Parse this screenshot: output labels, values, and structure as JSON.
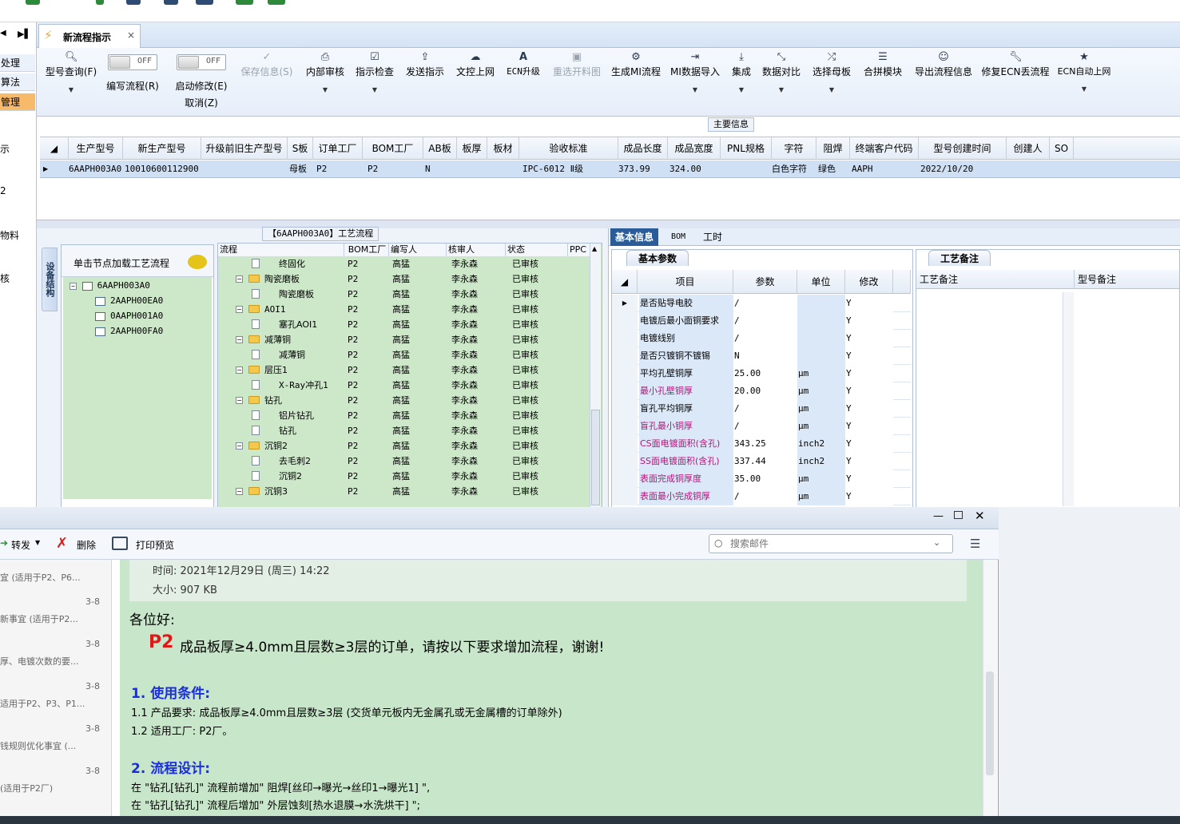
{
  "left_nav": {
    "items": [
      "处理",
      "算法",
      "管理"
    ],
    "plain": [
      "示",
      "2",
      "物料",
      "核"
    ]
  },
  "tab": {
    "label": "新流程指示",
    "close": "×"
  },
  "toolbar": {
    "model_query": "型号查询(F)",
    "write_flow": "编写流程(R)",
    "toggle_off": "OFF",
    "start_modify": "启动修改(E)",
    "cancel": "取消(Z)",
    "save_info": "保存信息(S)",
    "internal_review": "内部审核",
    "instruction_check": "指示检查",
    "send_instruction": "发送指示",
    "doc_upload": "文控上网",
    "ecn_upgrade": "ECN升级",
    "reselect_drawing": "重选开料图",
    "gen_mi_flow": "生成MI流程",
    "mi_import": "MI数据导入",
    "integrate": "集成",
    "data_compare": "数据对比",
    "select_mother": "选择母板",
    "merge_module": "合拼模块",
    "export_flow": "导出流程信息",
    "repair_ecn": "修复ECN丢流程",
    "ecn_auto": "ECN自动上网"
  },
  "main_info": {
    "title": "主要信息",
    "columns": [
      "生产型号",
      "新生产型号",
      "升级前旧生产型号",
      "S板",
      "订单工厂",
      "BOM工厂",
      "AB板",
      "板厚",
      "板材",
      "验收标准",
      "成品长度",
      "成品宽度",
      "PNL规格",
      "字符",
      "阻焊",
      "终端客户代码",
      "型号创建时间",
      "创建人",
      "SO"
    ],
    "row": {
      "prod_model": "6AAPH003A0",
      "new_model": "10010600112900",
      "s_board": "母板",
      "order_factory": "P2",
      "bom_factory": "P2",
      "ab_board": "N",
      "standard": "IPC-6012 Ⅱ级",
      "length": "373.99",
      "width": "324.00",
      "char": "白色字符",
      "solder": "绿色",
      "customer": "AAPH",
      "created": "2022/10/20"
    }
  },
  "process": {
    "title": "【6AAPH003A0】工艺流程",
    "side_tab": "设备结构",
    "load_hint": "单击节点加载工艺流程",
    "tree": [
      "6AAPH003A0",
      "2AAPH00EA0",
      "0AAPH001A0",
      "2AAPH00FA0"
    ],
    "columns": [
      "流程",
      "BOM工厂",
      "编写人",
      "核审人",
      "状态",
      "PPC"
    ],
    "rows": [
      {
        "name": "终固化",
        "level": 2,
        "bom": "P2",
        "writer": "高猛",
        "reviewer": "李永森",
        "status": "已审核"
      },
      {
        "name": "陶瓷磨板",
        "level": 1,
        "bom": "P2",
        "writer": "高猛",
        "reviewer": "李永森",
        "status": "已审核"
      },
      {
        "name": "陶瓷磨板",
        "level": 2,
        "bom": "P2",
        "writer": "高猛",
        "reviewer": "李永森",
        "status": "已审核"
      },
      {
        "name": "AOI1",
        "level": 1,
        "bom": "P2",
        "writer": "高猛",
        "reviewer": "李永森",
        "status": "已审核"
      },
      {
        "name": "塞孔AOI1",
        "level": 2,
        "bom": "P2",
        "writer": "高猛",
        "reviewer": "李永森",
        "status": "已审核"
      },
      {
        "name": "减薄铜",
        "level": 1,
        "bom": "P2",
        "writer": "高猛",
        "reviewer": "李永森",
        "status": "已审核"
      },
      {
        "name": "减薄铜",
        "level": 2,
        "bom": "P2",
        "writer": "高猛",
        "reviewer": "李永森",
        "status": "已审核"
      },
      {
        "name": "层压1",
        "level": 1,
        "bom": "P2",
        "writer": "高猛",
        "reviewer": "李永森",
        "status": "已审核"
      },
      {
        "name": "X-Ray冲孔1",
        "level": 2,
        "bom": "P2",
        "writer": "高猛",
        "reviewer": "李永森",
        "status": "已审核"
      },
      {
        "name": "钻孔",
        "level": 1,
        "bom": "P2",
        "writer": "高猛",
        "reviewer": "李永森",
        "status": "已审核"
      },
      {
        "name": "铝片钻孔",
        "level": 2,
        "bom": "P2",
        "writer": "高猛",
        "reviewer": "李永森",
        "status": "已审核"
      },
      {
        "name": "钻孔",
        "level": 2,
        "bom": "P2",
        "writer": "高猛",
        "reviewer": "李永森",
        "status": "已审核"
      },
      {
        "name": "沉铜2",
        "level": 1,
        "bom": "P2",
        "writer": "高猛",
        "reviewer": "李永森",
        "status": "已审核"
      },
      {
        "name": "去毛刺2",
        "level": 2,
        "bom": "P2",
        "writer": "高猛",
        "reviewer": "李永森",
        "status": "已审核"
      },
      {
        "name": "沉铜2",
        "level": 2,
        "bom": "P2",
        "writer": "高猛",
        "reviewer": "李永森",
        "status": "已审核"
      },
      {
        "name": "沉铜3",
        "level": 1,
        "bom": "P2",
        "writer": "高猛",
        "reviewer": "李永森",
        "status": "已审核"
      }
    ]
  },
  "right_tabs": [
    "基本信息",
    "BOM",
    "工时"
  ],
  "basic": {
    "subtab": "基本参数",
    "columns": [
      "项目",
      "参数",
      "单位",
      "修改"
    ],
    "rows": [
      {
        "item": "是否贴导电胶",
        "param": "/",
        "unit": "",
        "mod": "Y",
        "pink": false
      },
      {
        "item": "电镀后最小面铜要求",
        "param": "/",
        "unit": "",
        "mod": "Y",
        "pink": false
      },
      {
        "item": "电镀线别",
        "param": "/",
        "unit": "",
        "mod": "Y",
        "pink": false
      },
      {
        "item": "是否只镀铜不镀锡",
        "param": "N",
        "unit": "",
        "mod": "Y",
        "pink": false
      },
      {
        "item": "平均孔壁铜厚",
        "param": "25.00",
        "unit": "μm",
        "mod": "Y",
        "pink": false
      },
      {
        "item": "最小孔壁铜厚",
        "param": "20.00",
        "unit": "μm",
        "mod": "Y",
        "pink": true
      },
      {
        "item": "盲孔平均铜厚",
        "param": "/",
        "unit": "μm",
        "mod": "Y",
        "pink": false
      },
      {
        "item": "盲孔最小铜厚",
        "param": "/",
        "unit": "μm",
        "mod": "Y",
        "pink": true
      },
      {
        "item": "CS面电镀面积(含孔)",
        "param": "343.25",
        "unit": "inch2",
        "mod": "Y",
        "pink": true
      },
      {
        "item": "SS面电镀面积(含孔)",
        "param": "337.44",
        "unit": "inch2",
        "mod": "Y",
        "pink": true
      },
      {
        "item": "表面完成铜厚度",
        "param": "35.00",
        "unit": "μm",
        "mod": "Y",
        "pink": true
      },
      {
        "item": "表面最小完成铜厚",
        "param": "/",
        "unit": "μm",
        "mod": "Y",
        "pink": true
      }
    ]
  },
  "notes": {
    "tab": "工艺备注",
    "col1": "工艺备注",
    "col2": "型号备注"
  },
  "mail": {
    "forward": "转发",
    "delete": "删除",
    "print_preview": "打印预览",
    "search_placeholder": "搜索邮件",
    "time": "时间: 2021年12月29日 (周三) 14:22",
    "size": "大小: 907 KB",
    "greeting": "各位好:",
    "lead_factory": "P2",
    "lead_text": "成品板厚≥4.0mm且层数≥3层的订单，请按以下要求增加流程，谢谢!",
    "sec1": "1. 使用条件:",
    "s1_1": "1.1  产品要求: 成品板厚≥4.0mm且层数≥3层 (交货单元板内无金属孔或无金属槽的订单除外)",
    "s1_2": "1.2  适用工厂: P2厂。",
    "sec2": "2. 流程设计:",
    "s2_1": "在 \"钻孔[钻孔]\" 流程前增加\" 阻焊[丝印→曝光→丝印1→曝光1] \",",
    "s2_2": "在 \"钻孔[钻孔]\" 流程后增加\" 外层蚀刻[热水退膜→水洗烘干] \";",
    "list": [
      {
        "date": "3-8",
        "text": "新事宜 (适用于P2..."
      },
      {
        "date": "3-8",
        "text": "厚、电镀次数的要..."
      },
      {
        "date": "3-8",
        "text": "适用于P2、P3、P1..."
      },
      {
        "date": "3-8",
        "text": "钱规则优化事宜 (..."
      },
      {
        "date": "3-8",
        "text": "(适用于P2厂)"
      }
    ],
    "top_item": "宜 (适用于P2、P6..."
  }
}
